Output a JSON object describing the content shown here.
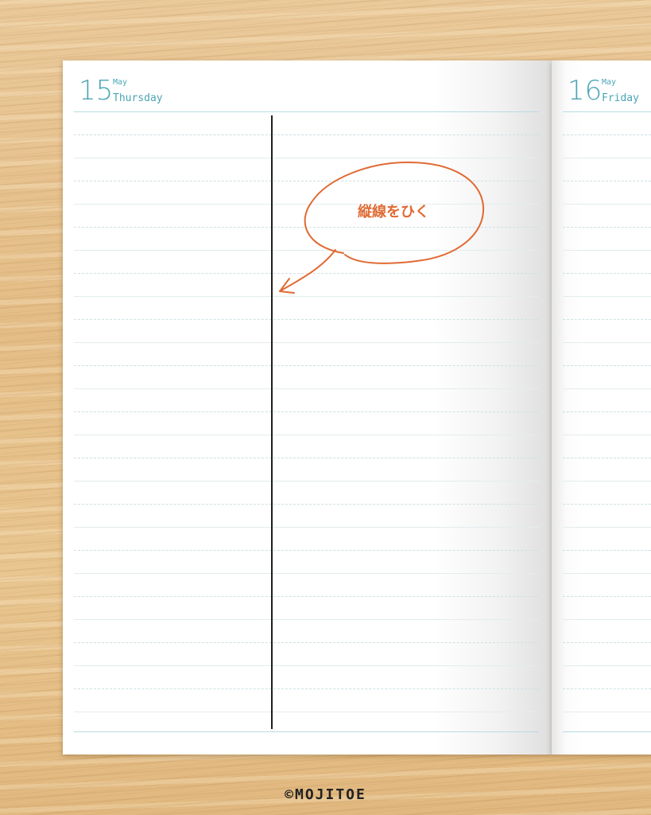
{
  "left_page": {
    "day": "15",
    "month": "May",
    "weekday": "Thursday"
  },
  "right_page": {
    "day": "16",
    "month": "May",
    "weekday": "Friday"
  },
  "callout": {
    "text": "縦線をひく"
  },
  "footer": {
    "logo": "©MOJITOE"
  },
  "colors": {
    "accent": "#4aa5b5",
    "annotation": "#e06a33",
    "divider": "#1e1e1e"
  }
}
